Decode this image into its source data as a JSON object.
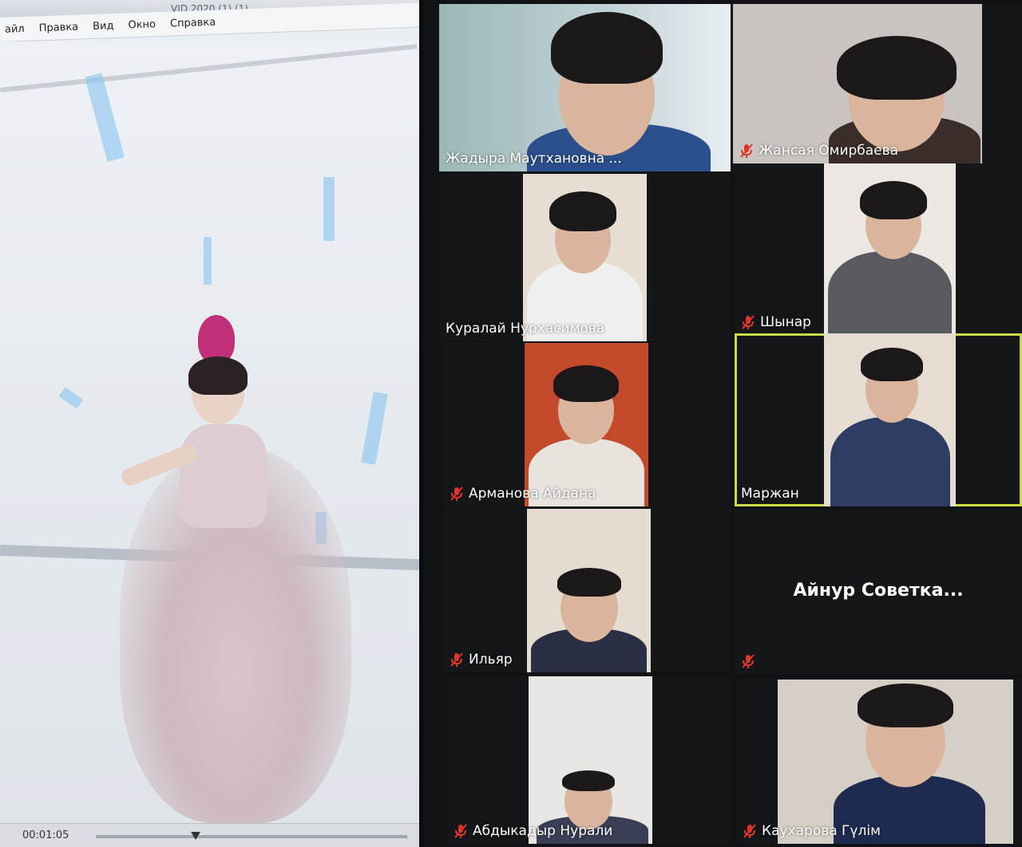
{
  "player": {
    "title": "VID 2020 (1) (1)",
    "menu": [
      "айл",
      "Правка",
      "Вид",
      "Окно",
      "Справка"
    ],
    "timecode": "00:01:05",
    "progress": 0.32
  },
  "colors": {
    "active_border": "#c9d94a",
    "mic_muted": "#e0352b",
    "gallery_bg": "#121317"
  },
  "participants": [
    {
      "name": "Жадыра Маутхановна ...",
      "muted": false
    },
    {
      "name": "Жансая Омирбаева",
      "muted": true
    },
    {
      "name": "Куралай Нурхасимова",
      "muted": false
    },
    {
      "name": "Шынар",
      "muted": true
    },
    {
      "name": "Арманова Айдана",
      "muted": true
    },
    {
      "name": "Маржан",
      "muted": false,
      "active": true
    },
    {
      "name": "Ильяр",
      "muted": true
    },
    {
      "name": "Айнур  Советка...",
      "muted": true,
      "video_off": true
    },
    {
      "name": "Абдыкадыр Нурали",
      "muted": true
    },
    {
      "name": "Каухарова Гүлім",
      "muted": true
    }
  ],
  "icons": {
    "mic_muted": "mic-muted-icon"
  }
}
